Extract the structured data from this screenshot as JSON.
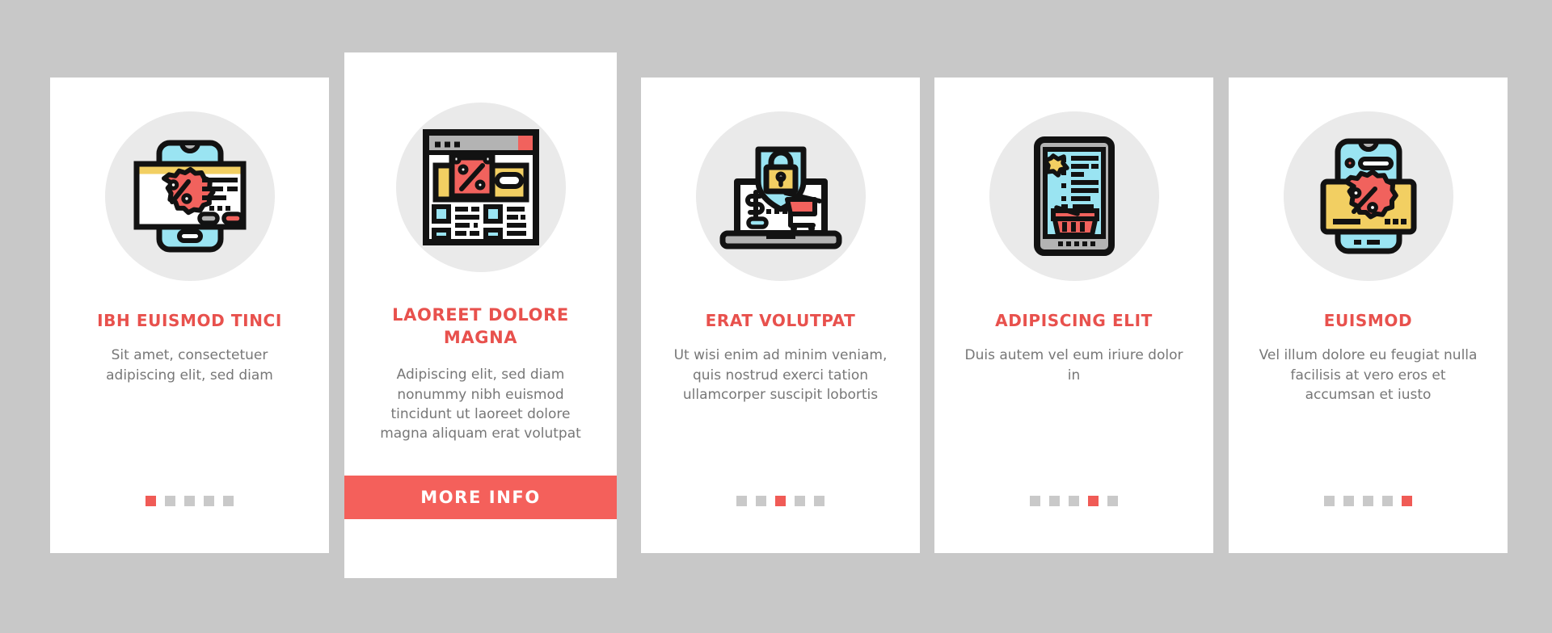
{
  "theme": {
    "background": "#c8c8c8",
    "card_background": "#ffffff",
    "accent_red": "#e8514d",
    "button_red": "#f4605b",
    "dot_inactive": "#c9c9c9",
    "dot_active": "#f05b56",
    "icon_circle": "#eaeaea",
    "icon_yellow": "#f2cf62",
    "icon_cyan": "#9ae4f2",
    "icon_red": "#f1625d",
    "icon_gray": "#b3b3b3",
    "icon_outline": "#121212",
    "title_color": "#e8514d",
    "desc_color": "#777777"
  },
  "cards": [
    {
      "id": "card-1",
      "featured": false,
      "icon_name": "phone-discount-card-icon",
      "title": "IBH EUISMOD TINCI",
      "description": "Sit amet, consectetuer adipiscing elit, sed diam",
      "dots": {
        "count": 5,
        "active_index": 0
      },
      "button": null
    },
    {
      "id": "card-2",
      "featured": true,
      "icon_name": "browser-discount-page-icon",
      "title": "LAOREET DOLORE MAGNA",
      "description": "Adipiscing elit, sed diam nonummy nibh euismod tincidunt ut laoreet dolore magna aliquam erat volutpat",
      "dots": null,
      "button": {
        "label": "MORE INFO"
      }
    },
    {
      "id": "card-3",
      "featured": false,
      "icon_name": "laptop-secure-shopping-icon",
      "title": "ERAT VOLUTPAT",
      "description": "Ut wisi enim ad minim veniam, quis nostrud exerci tation ullamcorper suscipit lobortis",
      "dots": {
        "count": 5,
        "active_index": 2
      },
      "button": null
    },
    {
      "id": "card-4",
      "featured": false,
      "icon_name": "tablet-shopping-list-icon",
      "title": "ADIPISCING ELIT",
      "description": "Duis autem vel eum iriure dolor in",
      "dots": {
        "count": 5,
        "active_index": 3
      },
      "button": null
    },
    {
      "id": "card-5",
      "featured": false,
      "icon_name": "phone-discount-badge-icon",
      "title": "EUISMOD",
      "description": "Vel illum dolore eu feugiat nulla facilisis at vero eros et accumsan et iusto",
      "dots": {
        "count": 5,
        "active_index": 4
      },
      "button": null
    }
  ]
}
